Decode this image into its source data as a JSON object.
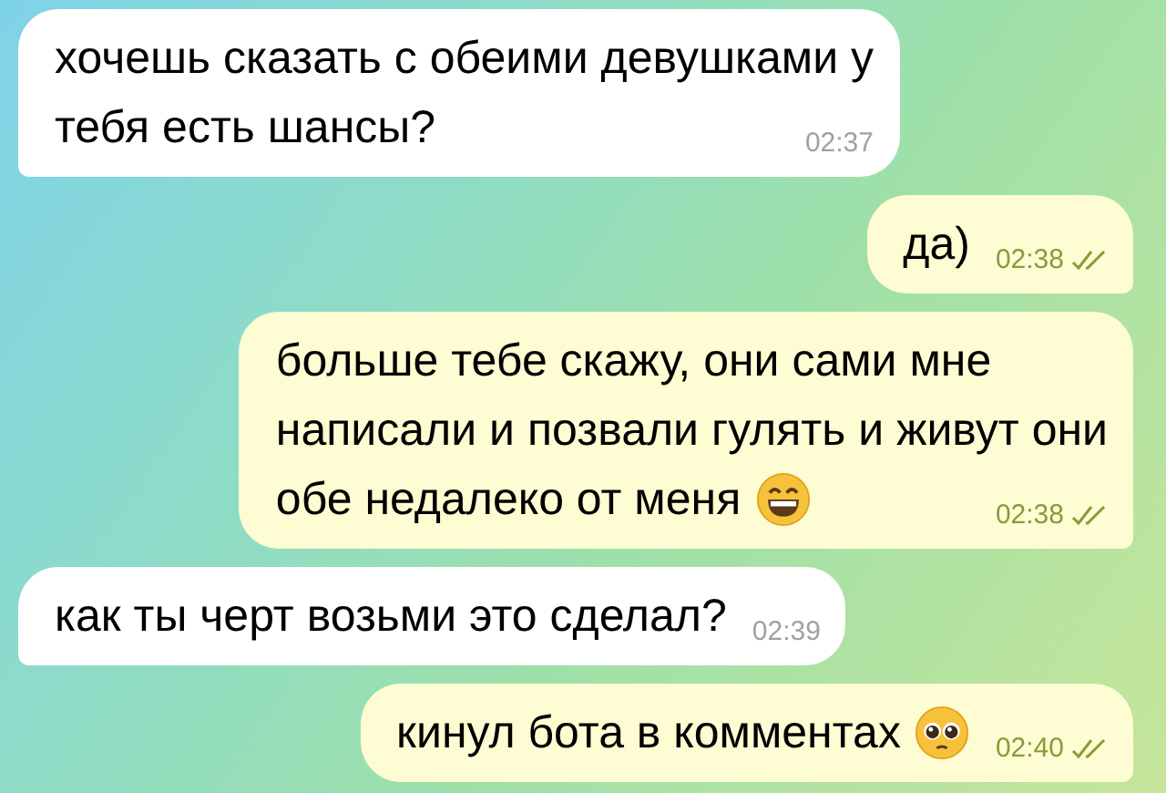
{
  "messages": [
    {
      "kind": "incoming",
      "lines": [
        "хочешь сказать с обеими девушками у",
        "тебя есть шансы?"
      ],
      "time": "02:37"
    },
    {
      "kind": "outgoing",
      "lines": [
        "да)"
      ],
      "time": "02:38",
      "read": true
    },
    {
      "kind": "outgoing",
      "lines": [
        "больше тебе скажу, они сами мне",
        "написали и позвали гулять и живут они",
        "обе недалеко от меня"
      ],
      "emoji": {
        "kind": "grinning"
      },
      "time": "02:38",
      "read": true
    },
    {
      "kind": "incoming",
      "lines": [
        "как ты черт возьми это сделал?"
      ],
      "time": "02:39"
    },
    {
      "kind": "outgoing",
      "lines": [
        "кинул бота в комментах"
      ],
      "emoji": {
        "kind": "pleading"
      },
      "time": "02:40",
      "read": true
    }
  ]
}
